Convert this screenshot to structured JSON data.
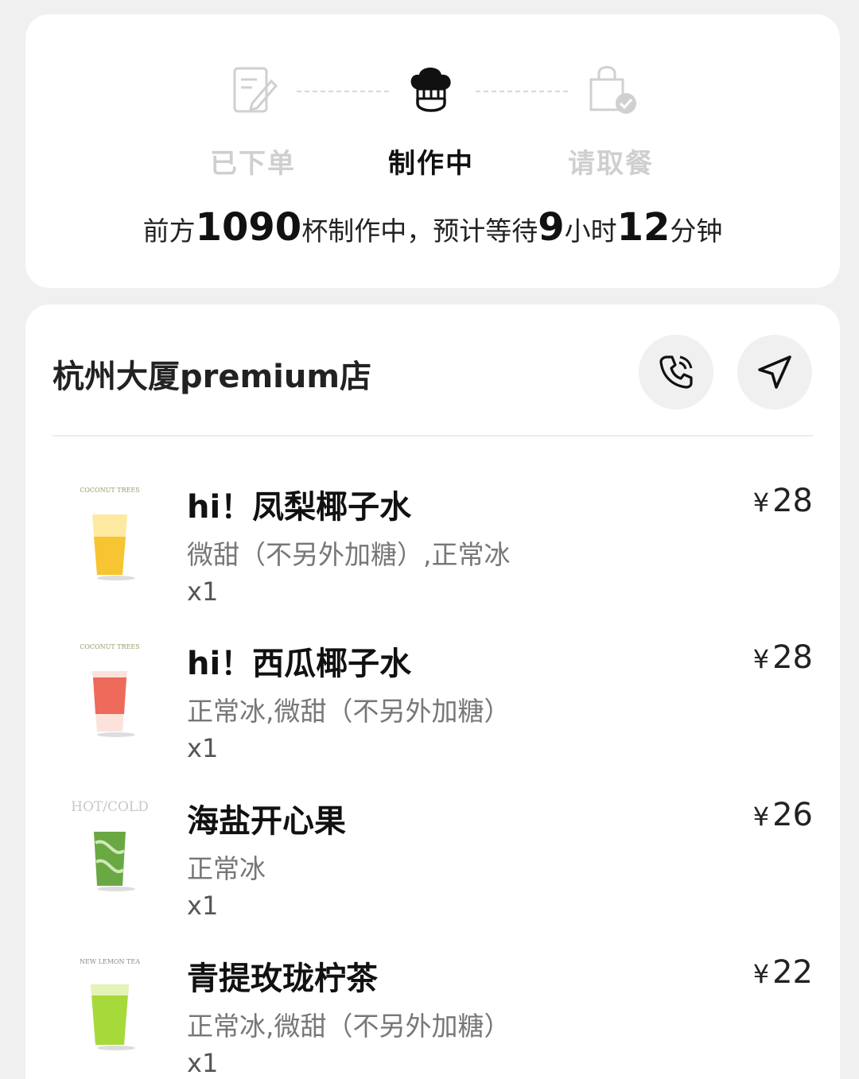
{
  "progress": {
    "steps": [
      {
        "label": "已下单",
        "icon": "order-form-icon",
        "state": "done"
      },
      {
        "label": "制作中",
        "icon": "chef-hat-icon",
        "state": "active"
      },
      {
        "label": "请取餐",
        "icon": "shopping-bag-check-icon",
        "state": "pending"
      }
    ],
    "wait": {
      "prefix": "前方",
      "cups_ahead": "1090",
      "middle": "杯制作中，预计等待",
      "hours": "9",
      "hours_unit": "小时",
      "minutes": "12",
      "minutes_unit": "分钟"
    }
  },
  "store": {
    "name": "杭州大厦premium店",
    "phone_icon": "phone-call-icon",
    "nav_icon": "navigation-arrow-icon"
  },
  "items": [
    {
      "name": "hi！凤梨椰子水",
      "spec": "微甜（不另外加糖）,正常冰",
      "qty": "x1",
      "currency": "¥",
      "price": "28",
      "thumb_label": "COCONUT TREES",
      "thumb_color": "#f7c531"
    },
    {
      "name": "hi！西瓜椰子水",
      "spec": "正常冰,微甜（不另外加糖）",
      "qty": "x1",
      "currency": "¥",
      "price": "28",
      "thumb_label": "COCONUT TREES",
      "thumb_color": "#ee6a5a"
    },
    {
      "name": "海盐开心果",
      "spec": "正常冰",
      "qty": "x1",
      "currency": "¥",
      "price": "26",
      "thumb_label": "HOT/COLD",
      "thumb_color": "#6aa843"
    },
    {
      "name": "青提玫珑柠茶",
      "spec": "正常冰,微甜（不另外加糖）",
      "qty": "x1",
      "currency": "¥",
      "price": "22",
      "thumb_label": "NEW LEMON TEA",
      "thumb_color": "#a6d93a"
    }
  ],
  "colors": {
    "background": "#f0f0f0",
    "card": "#ffffff",
    "inactive": "#cfcfcf"
  }
}
